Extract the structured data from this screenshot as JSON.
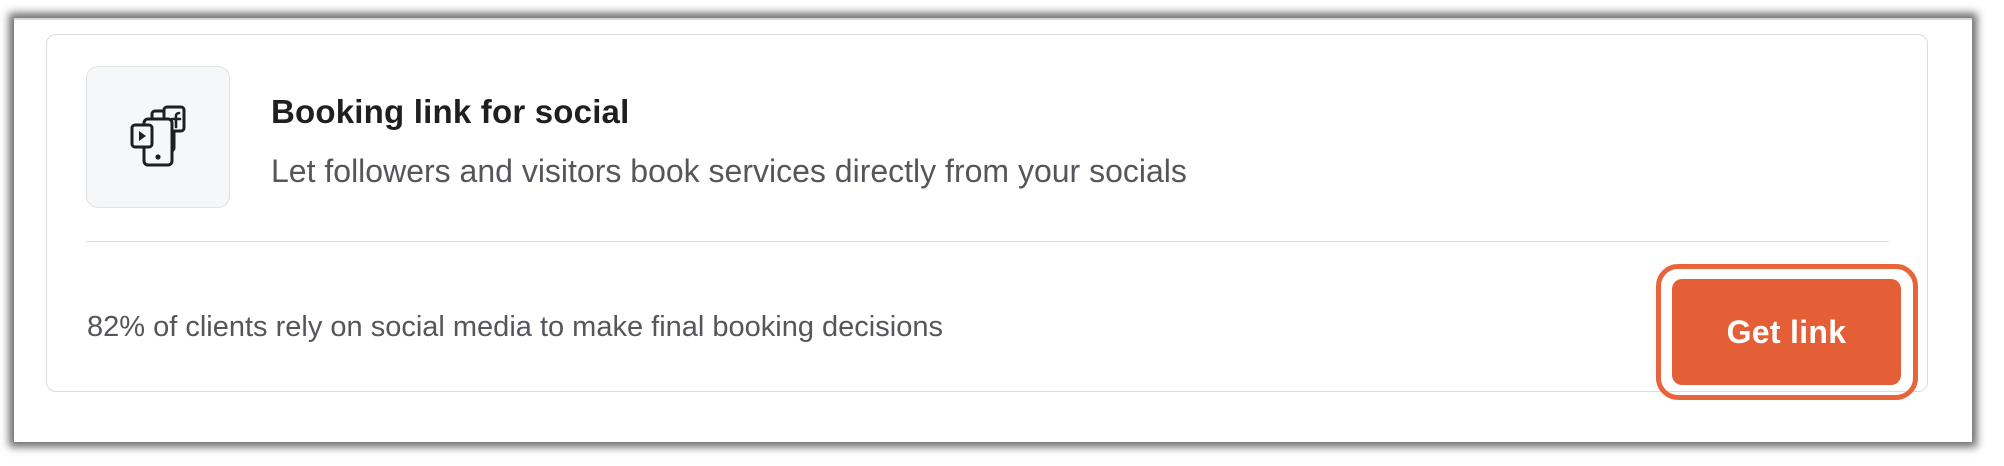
{
  "card": {
    "title": "Booking link for social",
    "subtitle": "Let followers and visitors book services directly from your socials",
    "stat_text": "82% of clients rely on social media to make final booking decisions",
    "icon": "social-devices-icon"
  },
  "actions": {
    "get_link_label": "Get link"
  },
  "colors": {
    "accent": "#e45f35",
    "highlight_ring": "#e8643a",
    "title_text": "#1f1f22",
    "body_text": "#55565b",
    "tile_bg": "#f6f7f9",
    "border": "#dcdcdf"
  }
}
